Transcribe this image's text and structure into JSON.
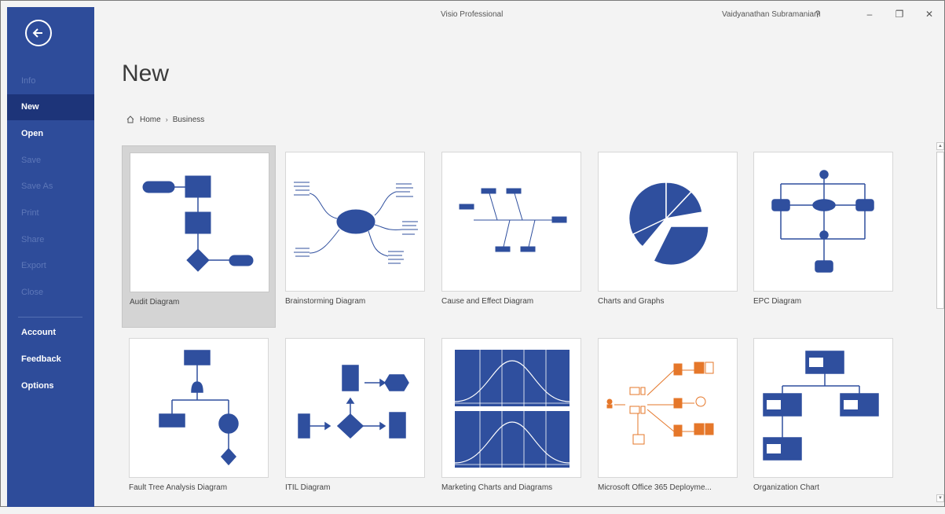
{
  "window": {
    "title": "Visio Professional",
    "user": "Vaidyanathan Subramaniam",
    "help_label": "?",
    "minimize_label": "–",
    "restore_label": "❐",
    "close_label": "✕"
  },
  "sidebar": {
    "items": [
      {
        "label": "Info",
        "enabled": false,
        "active": false
      },
      {
        "label": "New",
        "enabled": true,
        "active": true
      },
      {
        "label": "Open",
        "enabled": true,
        "active": false
      },
      {
        "label": "Save",
        "enabled": false,
        "active": false
      },
      {
        "label": "Save As",
        "enabled": false,
        "active": false
      },
      {
        "label": "Print",
        "enabled": false,
        "active": false
      },
      {
        "label": "Share",
        "enabled": false,
        "active": false
      },
      {
        "label": "Export",
        "enabled": false,
        "active": false
      },
      {
        "label": "Close",
        "enabled": false,
        "active": false
      },
      {
        "label": "Account",
        "enabled": true,
        "active": false
      },
      {
        "label": "Feedback",
        "enabled": true,
        "active": false
      },
      {
        "label": "Options",
        "enabled": true,
        "active": false
      }
    ]
  },
  "main": {
    "title": "New",
    "breadcrumb": {
      "home": "Home",
      "separator": "›",
      "current": "Business"
    },
    "templates": [
      {
        "label": "Audit Diagram",
        "selected": true
      },
      {
        "label": "Brainstorming Diagram",
        "selected": false
      },
      {
        "label": "Cause and Effect Diagram",
        "selected": false
      },
      {
        "label": "Charts and Graphs",
        "selected": false
      },
      {
        "label": "EPC Diagram",
        "selected": false
      },
      {
        "label": "Fault Tree Analysis Diagram",
        "selected": false
      },
      {
        "label": "ITIL Diagram",
        "selected": false
      },
      {
        "label": "Marketing Charts and Diagrams",
        "selected": false
      },
      {
        "label": "Microsoft Office 365 Deployme...",
        "selected": false
      },
      {
        "label": "Organization Chart",
        "selected": false
      }
    ]
  },
  "colors": {
    "sidebar": "#2e4c9a",
    "sidebar_active": "#1d3479",
    "shape_blue": "#2f4f9e",
    "shape_orange": "#e5772a"
  }
}
